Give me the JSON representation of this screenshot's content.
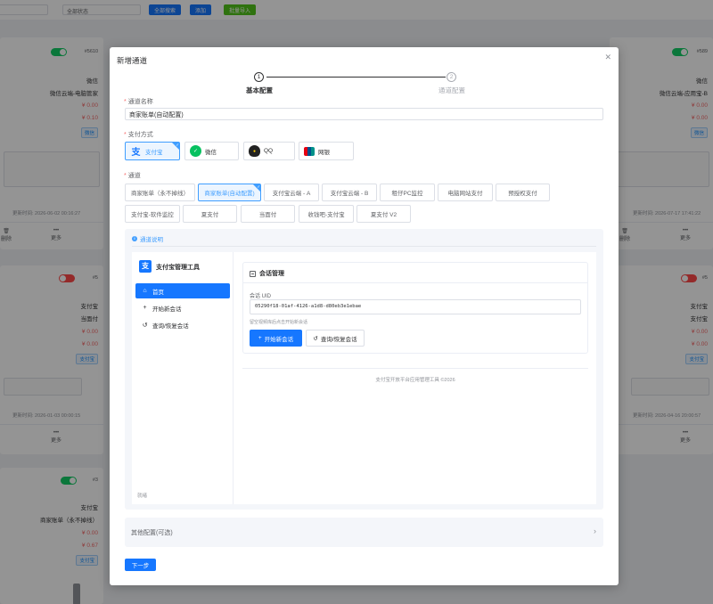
{
  "background": {
    "toolbar": {
      "status_select": "全部状态",
      "search_btn": "全部搜索",
      "add_btn": "添加",
      "import_btn": "批量导入"
    },
    "cards_left": [
      {
        "id": "#5610",
        "channel_type": "微信",
        "channel_name": "微信云端-电脑管家",
        "amount1": "¥ 0.00",
        "amount2": "¥ 0.10",
        "tag": "微信",
        "time": "更新时间: 2026-06-02 00:16:27",
        "action1": "删除",
        "action2": "更多",
        "status": "on"
      },
      {
        "id": "#5",
        "channel_type": "支付宝",
        "channel_name": "当面付",
        "amount1": "¥ 0.00",
        "amount2": "¥ 0.00",
        "tag": "支付宝",
        "time": "更新时间: 2026-01-03 00:00:15",
        "action1": "",
        "action2": "更多",
        "status": "off"
      },
      {
        "id": "#3",
        "channel_type": "支付宝",
        "channel_name": "商家账单（永不掉线）",
        "amount1": "¥ 0.00",
        "amount2": "¥ 0.67",
        "tag": "支付宝",
        "time": "",
        "action1": "",
        "action2": "",
        "status": "on"
      }
    ],
    "cards_right": [
      {
        "id": "#589",
        "channel_type": "微信",
        "channel_name": "微信云端-应用宝-B",
        "amount1": "¥ 0.00",
        "amount2": "¥ 0.00",
        "tag": "微信",
        "time": "更新时间: 2026-07-17 17:41:22",
        "action1": "删除",
        "action2": "更多",
        "status": "on"
      },
      {
        "id": "#5",
        "channel_type": "支付宝",
        "channel_name": "支付宝",
        "amount1": "¥ 0.00",
        "amount2": "¥ 0.00",
        "tag": "支付宝",
        "time": "更新时间: 2026-04-16 20:00:57",
        "action1": "",
        "action2": "更多",
        "status": "off"
      }
    ]
  },
  "dialog": {
    "title": "新增通道",
    "close_icon": "close-icon",
    "steps": [
      {
        "num": "1",
        "label": "基本配置",
        "active": true
      },
      {
        "num": "2",
        "label": "通道配置",
        "active": false
      }
    ],
    "name_label": "通道名称",
    "name_value": "商家账单(自动配置)",
    "pay_label": "支付方式",
    "pay_methods": [
      {
        "label": "支付宝",
        "icon": "alipay-icon",
        "selected": true
      },
      {
        "label": "微信",
        "icon": "wechat-icon",
        "selected": false
      },
      {
        "label": "QQ",
        "icon": "qq-icon",
        "selected": false
      },
      {
        "label": "网银",
        "icon": "unionpay-icon",
        "selected": false
      }
    ],
    "channel_label": "通道",
    "channels": [
      {
        "label": "商家账单（永不掉线）",
        "selected": false
      },
      {
        "label": "商家账单(自动配置)",
        "selected": true
      },
      {
        "label": "支付宝云端 - A",
        "selected": false
      },
      {
        "label": "支付宝云端 - B",
        "selected": false
      },
      {
        "label": "租仔PC监控",
        "selected": false
      },
      {
        "label": "电脑网站支付",
        "selected": false
      },
      {
        "label": "预授权支付",
        "selected": false
      },
      {
        "label": "支付宝-软件监控",
        "selected": false
      },
      {
        "label": "夏支付",
        "selected": false
      },
      {
        "label": "当面付",
        "selected": false
      },
      {
        "label": "收钱吧-支付宝",
        "selected": false
      },
      {
        "label": "夏支付 V2",
        "selected": false
      }
    ],
    "desc_title": "通道说明",
    "app": {
      "name": "支付宝管理工具",
      "logo_char": "支",
      "nav": [
        {
          "label": "首页",
          "icon": "home-icon",
          "active": true
        },
        {
          "label": "开始新会话",
          "icon": "plus-icon",
          "active": false
        },
        {
          "label": "查询/恢复会话",
          "icon": "history-icon",
          "active": false
        }
      ],
      "side_footer": "就绪",
      "session_title": "会话管理",
      "uid_label": "会话 UID",
      "uid_value": "05290f18-01af-4126-a1d8-d80eb3e1ebae",
      "uid_hint": "留空视频库后点击开始新会话",
      "start_btn": "开始新会话",
      "query_btn": "查询/恢复会话",
      "footer": "支付宝开放平台应用管理工具 ©2026"
    },
    "other_config": "其他配置(可选)",
    "next_btn": "下一步"
  }
}
